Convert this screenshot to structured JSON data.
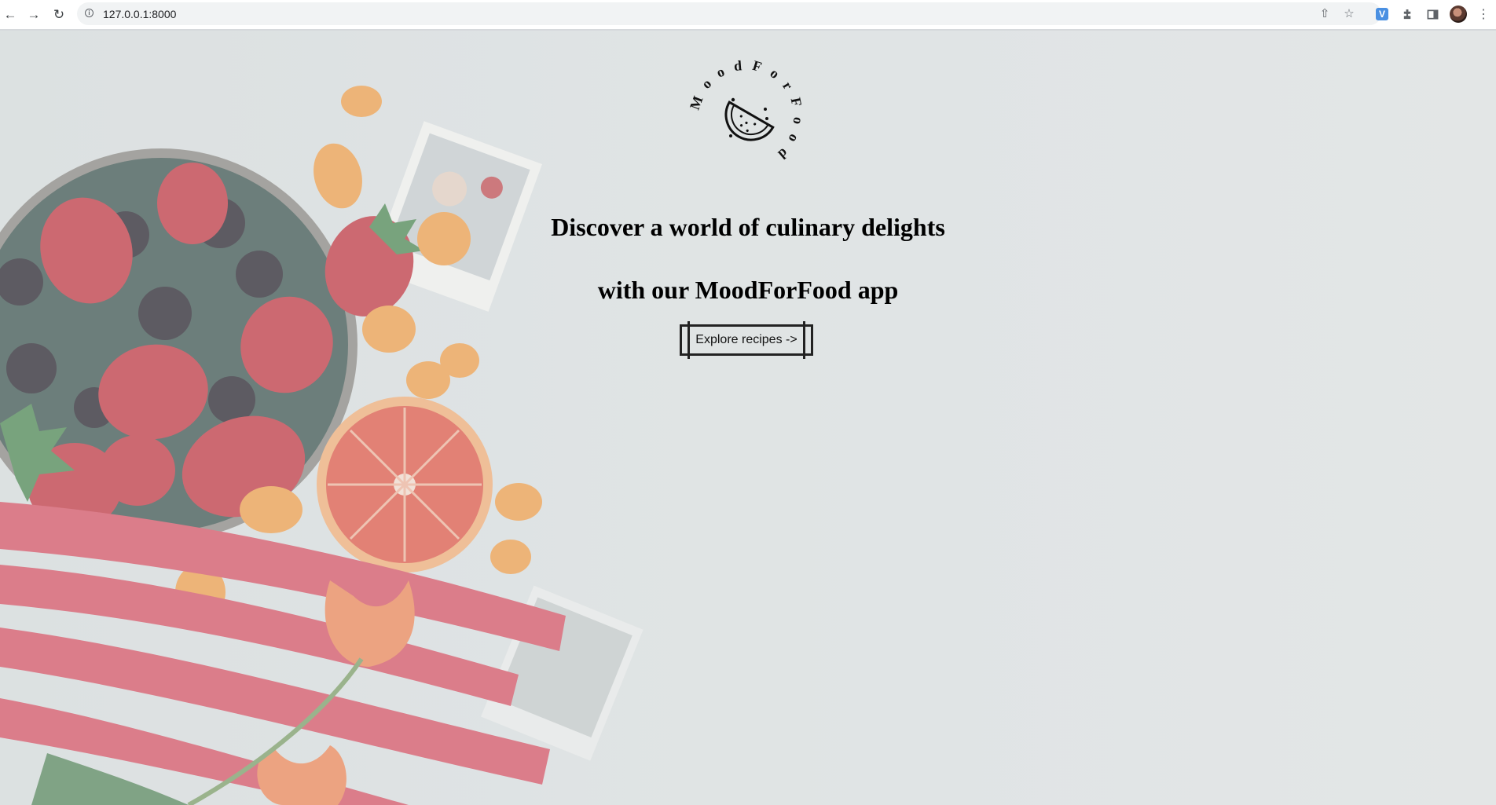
{
  "browser": {
    "url": "127.0.0.1:8000",
    "back_icon": "arrow-left-icon",
    "forward_icon": "arrow-right-icon",
    "reload_icon": "reload-icon",
    "extension_v_label": "V"
  },
  "logo": {
    "ring_text": "MoodForFood",
    "icon": "watermelon-slice-icon"
  },
  "hero": {
    "line1": "Discover a world of culinary delights",
    "line2": "with our MoodForFood app",
    "cta_label": "Explore recipes ->"
  },
  "colors": {
    "page_background": "#dfe3e4",
    "text": "#000000",
    "strawberry": "#c9434c",
    "rhubarb": "#d8606c",
    "orange": "#f0a25a"
  }
}
